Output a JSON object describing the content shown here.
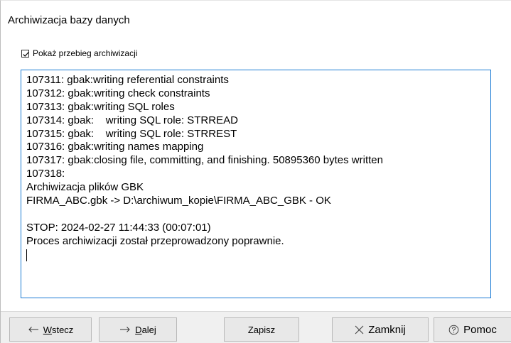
{
  "window": {
    "title": "Archiwizacja bazy danych"
  },
  "options": {
    "show_progress_label": "Pokaż przebieg archiwizacji",
    "show_progress_checked": true
  },
  "log": {
    "lines": [
      "107311: gbak:writing referential constraints",
      "107312: gbak:writing check constraints",
      "107313: gbak:writing SQL roles",
      "107314: gbak:    writing SQL role: STRREAD",
      "107315: gbak:    writing SQL role: STRREST",
      "107316: gbak:writing names mapping",
      "107317: gbak:closing file, committing, and finishing. 50895360 bytes written",
      "107318:",
      "Archiwizacja plików GBK",
      "FIRMA_ABC.gbk -> D:\\archiwum_kopie\\FIRMA_ABC_GBK - OK",
      "",
      "STOP: 2024-02-27 11:44:33 (00:07:01)",
      "Proces archiwizacji został przeprowadzony poprawnie."
    ]
  },
  "buttons": {
    "back_label": "Wstecz",
    "next_label": "Dalej",
    "save_label": "Zapisz",
    "close_label": "Zamknij",
    "help_label": "Pomoc"
  },
  "colors": {
    "log_border": "#1a7bd4",
    "footer_bg": "#f0f0f0",
    "button_bg": "#e8e8e8"
  },
  "icons": {
    "back": "arrow-left-icon",
    "next": "arrow-right-icon",
    "close": "x-icon",
    "help": "question-circle-icon",
    "checkbox": "checkmark-icon"
  }
}
